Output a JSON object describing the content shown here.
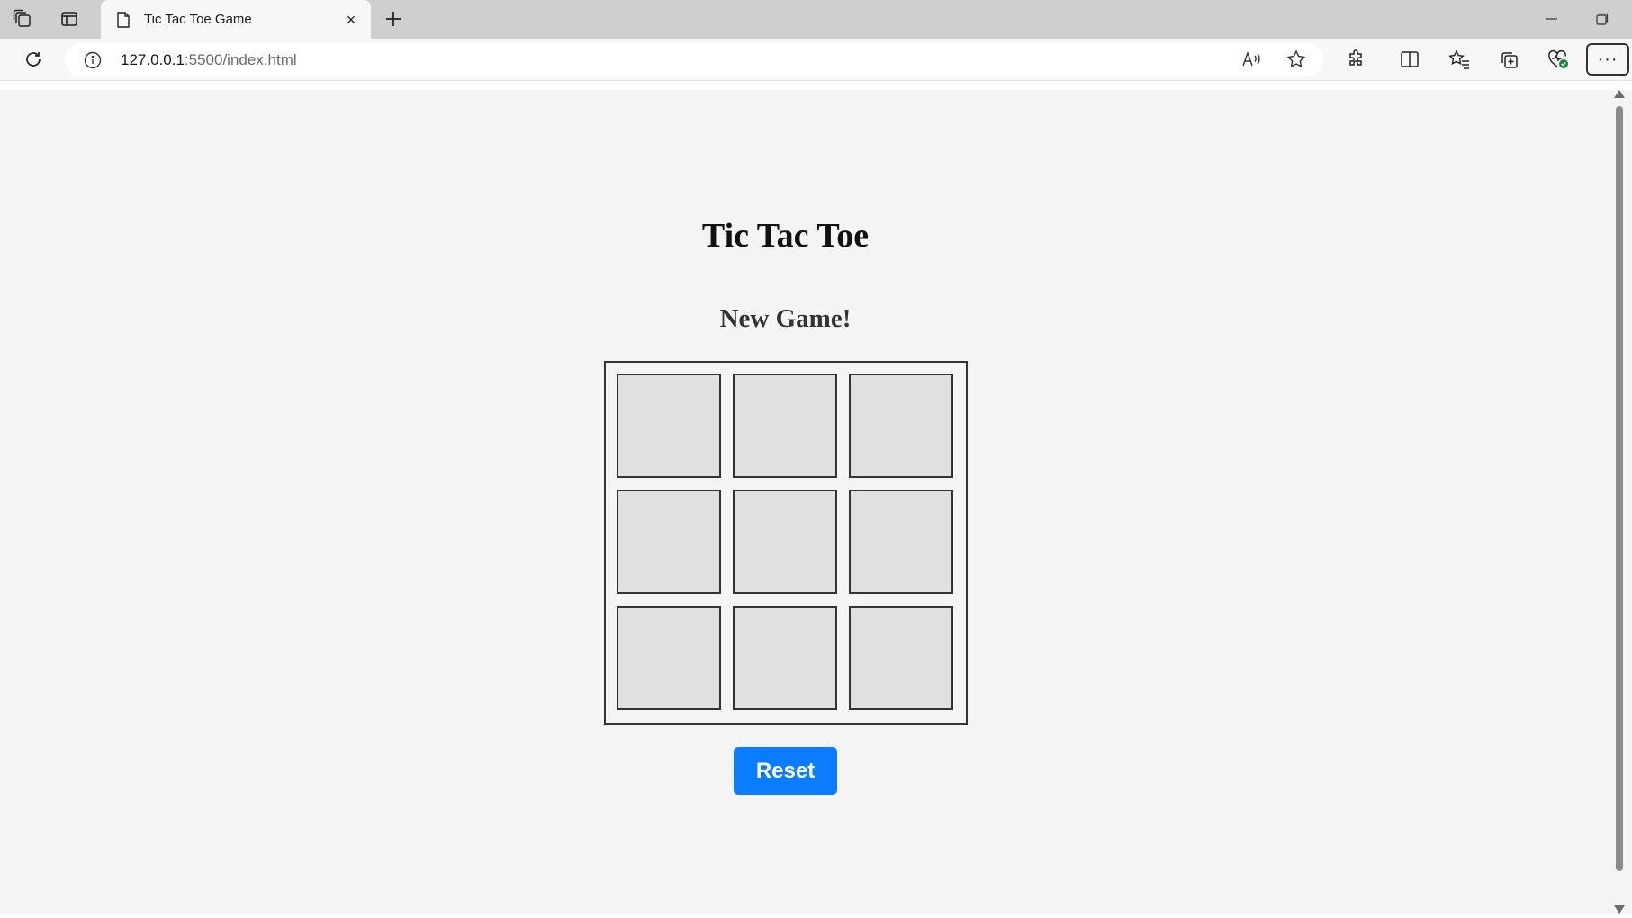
{
  "browser": {
    "tab": {
      "title": "Tic Tac Toe Game",
      "close_label": "×"
    },
    "new_tab_label": "+",
    "address": {
      "host": "127.0.0.1",
      "path": ":5500/index.html"
    },
    "menu_label": "···"
  },
  "page": {
    "title": "Tic Tac Toe",
    "status": "New Game!",
    "board": {
      "cells": [
        "",
        "",
        "",
        "",
        "",
        "",
        "",
        "",
        ""
      ]
    },
    "reset_label": "Reset"
  },
  "colors": {
    "accent": "#0a7cff",
    "page_bg": "#f4f4f4",
    "cell_bg": "#e0e0e0",
    "cell_border": "#333333"
  }
}
